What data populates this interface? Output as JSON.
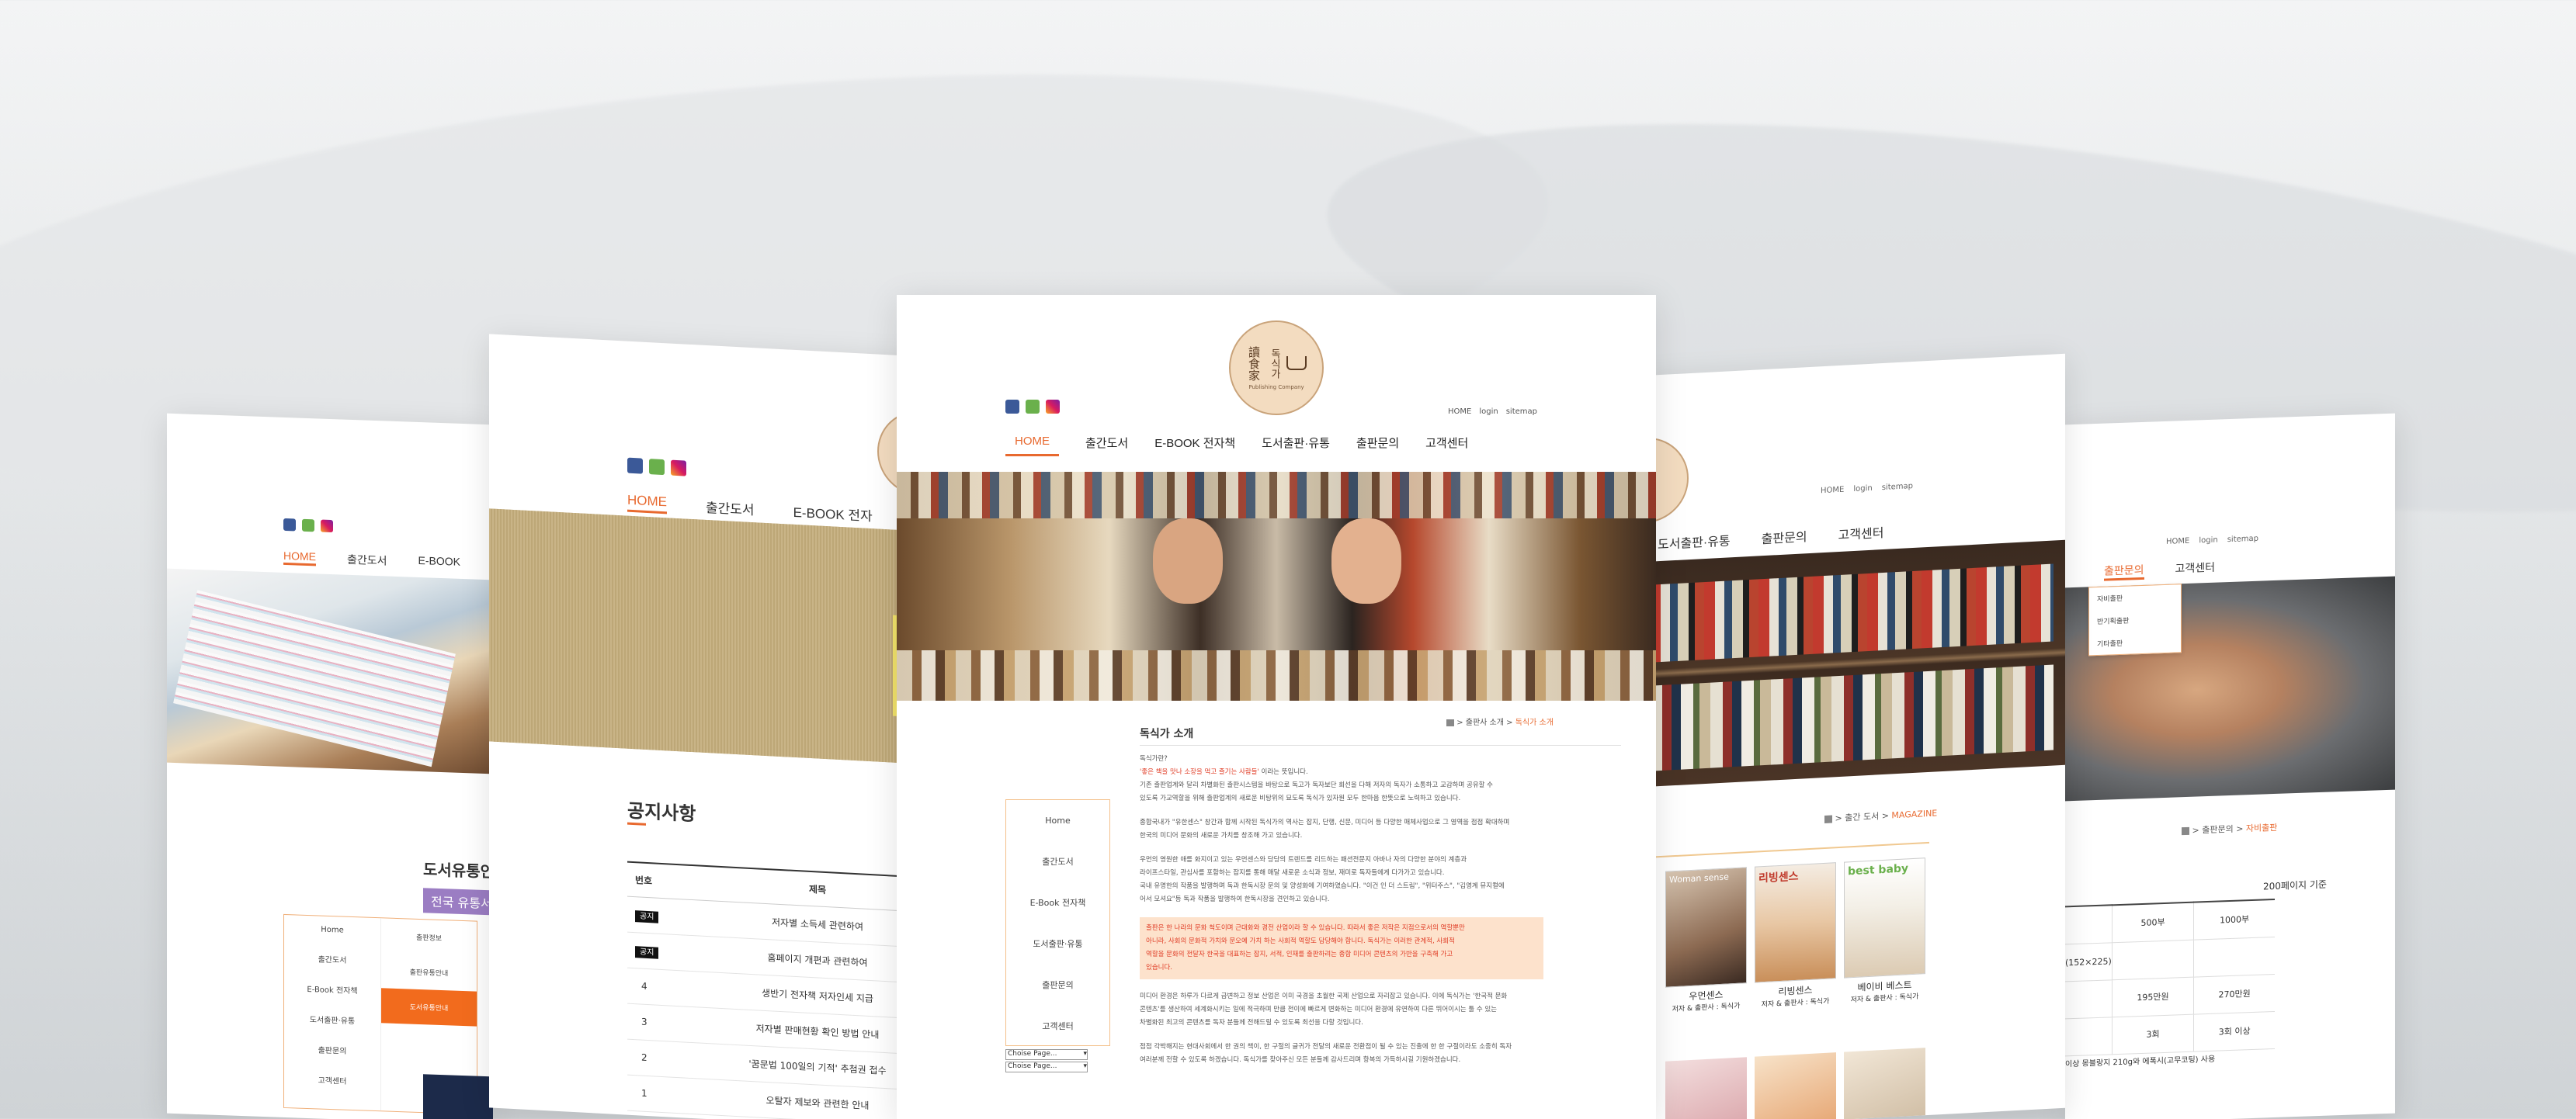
{
  "card1": {
    "nav": {
      "home": "HOME",
      "publish": "출간도서",
      "ebook": "E-BOOK"
    },
    "section_title": "도서유통안",
    "section_sub": "전국 유통서",
    "side_menu": [
      "Home",
      "출간도서",
      "E-Book 전자책",
      "도서출판·유통",
      "출판문의",
      "고객센터"
    ],
    "sub_menu": [
      "출판정보",
      "출판유통안내",
      "도서유통안내"
    ]
  },
  "card2": {
    "nav": {
      "home": "HOME",
      "publish": "출간도서",
      "ebook": "E-BOOK 전자"
    },
    "title": "공지사항",
    "table": {
      "headers": [
        "번호",
        "제목"
      ],
      "rows": [
        {
          "num": "공지",
          "notice": true,
          "title": "저자별 소득세 관련하여"
        },
        {
          "num": "공지",
          "notice": true,
          "title": "홈페이지 개편과 관련하여"
        },
        {
          "num": "4",
          "notice": false,
          "title": "생반기 전자책 저자인세 지급"
        },
        {
          "num": "3",
          "notice": false,
          "title": "저자별 판매현황 확인 방법 안내"
        },
        {
          "num": "2",
          "notice": false,
          "title": "'꿈문법 100일의 기적' 추첨권 접수"
        },
        {
          "num": "1",
          "notice": false,
          "title": "오탈자 제보와 관련한 안내"
        }
      ]
    }
  },
  "card3": {
    "top_links": [
      "HOME",
      "login",
      "sitemap"
    ],
    "logo": {
      "hanja": "讀食家",
      "hangul": "독식가",
      "sub": "Publishing Company"
    },
    "nav": [
      {
        "label": "HOME",
        "active": true
      },
      {
        "label": "출간도서"
      },
      {
        "label": "E-BOOK 전자책"
      },
      {
        "label": "도서출판·유통"
      },
      {
        "label": "출판문의"
      },
      {
        "label": "고객센터"
      }
    ],
    "breadcrumb": {
      "sep1": ">",
      "parent": "출판사 소개",
      "sep2": ">",
      "current": "독식가 소개"
    },
    "title": "독식가 소개",
    "side_menu": [
      "Home",
      "출간도서",
      "E-Book 전자책",
      "도서출판·유통",
      "출판문의",
      "고객센터"
    ],
    "selects": [
      "Choise Page...",
      "Choise Page..."
    ],
    "body": {
      "greet": "독식가란?",
      "quote": "'좋은 책을 맛나 소장을 먹고 즐기는 사람들'",
      "quote_tail": " 이라는 뜻입니다.",
      "p1": [
        "기존 출판업계와 달리 차별화된 출판시스템을 바탕으로 독고가 독자보단 회선을 다해 저자의 독자가 소통하고 교감하며 공유할 수",
        "있도록 가교역할을 위해 출판업계의 새로운 비탕위의 묘도록 독식가 있자원 모두 한마음 한뜻으로 노력하고 있습니다."
      ],
      "p2": [
        "종합국내가 \"유한센스\" 창간과 함께 시작된 독식가의 역사는 잡지, 단행, 신문, 미디어 등 다양한 매체사업으로 그 영역을 점점 확대하며",
        "한국의 미디어 문화의 새로운 가치를 창조해 가고 있습니다."
      ],
      "p3": [
        "우먼의 영원한 애를 화지이고 있는 우먼센스와 당당의 트렌드를 리드하는 패션전문지 아바나 자의 다양한 분야의 계층과",
        "라이프스타일, 관심사를 포함하는 잡지를 통해 매달 새로운 소식과 정보, 재미로 독자들에게 다가가고 있습니다.",
        "국내 유명한의 작품을 발행하며 독과 한독시장 문의 및 양성화에 기여하였습니다. \"이건 인 더 스트림\", \"위터주스\", \"김영계 뮤지컬에",
        "어서 모셔요\"등 독과 작품을 발행하여 한독시장을 견인하고 있습니다."
      ],
      "highlight": [
        "출판은 한 나라의 문화 척도이며 근대화와 경전 산업이라 할 수 있습니다. 따라서 좋은 저작은 지점으로서의 역할뿐만",
        "아니라, 사회의 문화적 가치와 문오예 가치 하는 사회적 역할도 담당해야 합니다. 독식가는 이러한 관계적, 사회적",
        "역할을 문화의 전달자 한국을 대표하는 잡지, 서적, 인재를 출판하려는 종합 미디어 콘텐츠의 가반을 구축해 가고",
        "있습니다."
      ],
      "p4": [
        "미디어 환경은 하루가 다르게 급변하고 정보 산업은 이미 국경을 초월한 국제 산업으로 자리잡고 있습니다. 이에 독식가는 '한국적 문화",
        "콘텐츠'를 생산하여 세계화시키는 일에 적극하며 만큼 전이에 빠르게 변화하는 미디어 환경에 유연하여 다른 뛰어이시는 툴 수 있는",
        "차별화된 최고의 콘텐츠를 독자 분들께 전해드릴 수 있도록 최선을 다할 것입니다."
      ],
      "p5": [
        "점점 각박해지는 현대사회에서 한 권의 책이, 한 구절의 글귀가 전달의 새로운 전환점이 될 수 있는 진출에 한 한 구절이라도 소중히 독자",
        "여러분께 전할 수 있도록 하겠습니다. 독식가를 찾아주신 모든 분들께 감사드리며 항복의 가득하시길 기원하겠습니다."
      ]
    }
  },
  "card4": {
    "top_links": [
      "HOME",
      "login",
      "sitemap"
    ],
    "nav": {
      "dist": "도서출판·유통",
      "inq": "출판문의",
      "cs": "고객센터"
    },
    "breadcrumb": {
      "sep1": ">",
      "parent": "출간 도서",
      "sep2": ">",
      "current": "MAGAZINE"
    },
    "books": [
      {
        "name": "우먼센스",
        "sub": "저자 & 출판사 : 독식가"
      },
      {
        "name": "리빙센스",
        "sub": "저자 & 출판사 : 독식가"
      },
      {
        "name": "베이비 베스트",
        "sub": "저자 & 출판사 : 독식가"
      }
    ],
    "cover_text": [
      "Woman sense",
      "리빙센스",
      "best baby"
    ]
  },
  "card5": {
    "top_links": [
      "HOME",
      "login",
      "sitemap"
    ],
    "nav": {
      "inq": "출판문의",
      "cs": "고객센터"
    },
    "dropdown": [
      "자비출판",
      "반기획출판",
      "기타출판"
    ],
    "breadcrumb": {
      "sep": ">",
      "parent": "출판문의",
      "sep2": ">",
      "current": "자비출판"
    },
    "note": "200페이지 기준",
    "table": [
      [
        "",
        "500부",
        "1000부"
      ],
      [
        "(152×225)",
        "",
        ""
      ],
      [
        "",
        "195만원",
        "270만원"
      ],
      [
        "",
        "3회",
        "3회 이상"
      ]
    ],
    "footnote": "이상 몽블랑지 210g와 에폭시(고무코팅) 사용"
  },
  "colors": {
    "accent": "#e8692f",
    "highlight_bg": "#fde2cc",
    "purple": "#9b7dc3",
    "submenu_active": "#f26b1d"
  }
}
